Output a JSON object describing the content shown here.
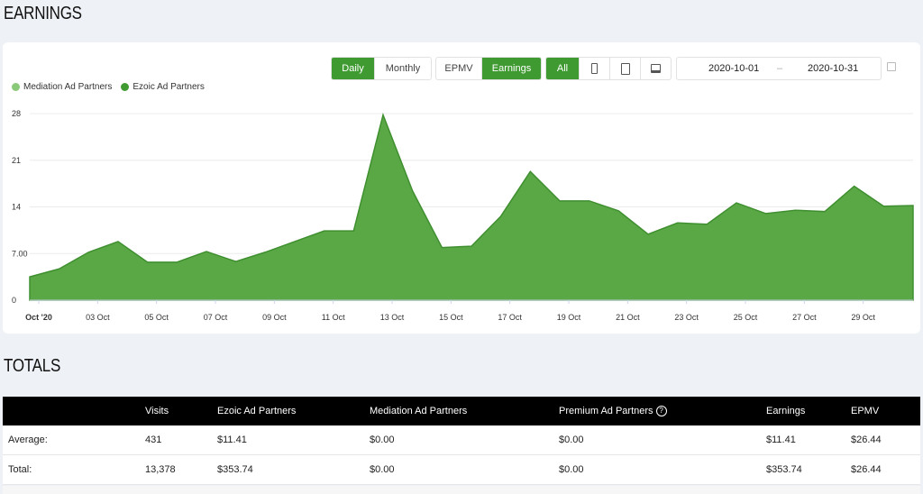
{
  "earnings_title": "EARNINGS",
  "totals_title": "TOTALS",
  "toolbar": {
    "period": [
      {
        "label": "Daily",
        "active": true
      },
      {
        "label": "Monthly",
        "active": false
      }
    ],
    "metric": [
      {
        "label": "EPMV",
        "active": false
      },
      {
        "label": "Earnings",
        "active": true
      }
    ],
    "device": {
      "all_label": "All",
      "icons": [
        "phone-icon",
        "tablet-icon",
        "desktop-icon"
      ]
    },
    "date_start": "2020-10-01",
    "date_sep": "–",
    "date_end": "2020-10-31",
    "calendar_icon": "calendar-icon"
  },
  "colors": {
    "accent": "#3f9a31",
    "area": "#5aa845",
    "mediation": "#8bc97a"
  },
  "chart_data": {
    "type": "area",
    "legend": [
      {
        "name": "Mediation Ad Partners",
        "color": "#8bc97a"
      },
      {
        "name": "Ezoic Ad Partners",
        "color": "#3f9a31"
      }
    ],
    "legend_placement": "top-left",
    "x": [
      "2020-10-01",
      "2020-10-02",
      "2020-10-03",
      "2020-10-04",
      "2020-10-05",
      "2020-10-06",
      "2020-10-07",
      "2020-10-08",
      "2020-10-09",
      "2020-10-10",
      "2020-10-11",
      "2020-10-12",
      "2020-10-13",
      "2020-10-14",
      "2020-10-15",
      "2020-10-16",
      "2020-10-17",
      "2020-10-18",
      "2020-10-19",
      "2020-10-20",
      "2020-10-21",
      "2020-10-22",
      "2020-10-23",
      "2020-10-24",
      "2020-10-25",
      "2020-10-26",
      "2020-10-27",
      "2020-10-28",
      "2020-10-29",
      "2020-10-30",
      "2020-10-31"
    ],
    "series": [
      {
        "name": "Ezoic Ad Partners",
        "values": [
          3.5,
          4.7,
          7.2,
          8.8,
          5.7,
          5.7,
          7.3,
          5.8,
          7.2,
          8.8,
          10.4,
          10.4,
          27.8,
          16.4,
          7.9,
          8.1,
          12.6,
          19.3,
          14.9,
          14.9,
          13.4,
          9.9,
          11.6,
          11.4,
          14.6,
          13.0,
          13.5,
          13.3,
          17.1,
          14.1,
          14.2
        ]
      },
      {
        "name": "Mediation Ad Partners",
        "values": [
          0,
          0,
          0,
          0,
          0,
          0,
          0,
          0,
          0,
          0,
          0,
          0,
          0,
          0,
          0,
          0,
          0,
          0,
          0,
          0,
          0,
          0,
          0,
          0,
          0,
          0,
          0,
          0,
          0,
          0,
          0
        ]
      }
    ],
    "ylim": [
      0,
      28
    ],
    "yticks": [
      "0",
      "7.00",
      "14",
      "21",
      "28"
    ],
    "xticks": [
      {
        "day": 1,
        "label": "Oct '20"
      },
      {
        "day": 3,
        "label": "03 Oct"
      },
      {
        "day": 5,
        "label": "05 Oct"
      },
      {
        "day": 7,
        "label": "07 Oct"
      },
      {
        "day": 9,
        "label": "09 Oct"
      },
      {
        "day": 11,
        "label": "11 Oct"
      },
      {
        "day": 13,
        "label": "13 Oct"
      },
      {
        "day": 15,
        "label": "15 Oct"
      },
      {
        "day": 17,
        "label": "17 Oct"
      },
      {
        "day": 19,
        "label": "19 Oct"
      },
      {
        "day": 21,
        "label": "21 Oct"
      },
      {
        "day": 23,
        "label": "23 Oct"
      },
      {
        "day": 25,
        "label": "25 Oct"
      },
      {
        "day": 27,
        "label": "27 Oct"
      },
      {
        "day": 29,
        "label": "29 Oct"
      }
    ],
    "grid": true
  },
  "totals": {
    "headers": [
      "",
      "Visits",
      "Ezoic Ad Partners",
      "Mediation Ad Partners",
      "Premium Ad Partners",
      "Earnings",
      "EPMV"
    ],
    "help_icon": "?",
    "rows": [
      [
        "Average:",
        "431",
        "$11.41",
        "$0.00",
        "$0.00",
        "$11.41",
        "$26.44"
      ],
      [
        "Total:",
        "13,378",
        "$353.74",
        "$0.00",
        "$0.00",
        "$353.74",
        "$26.44"
      ]
    ]
  }
}
